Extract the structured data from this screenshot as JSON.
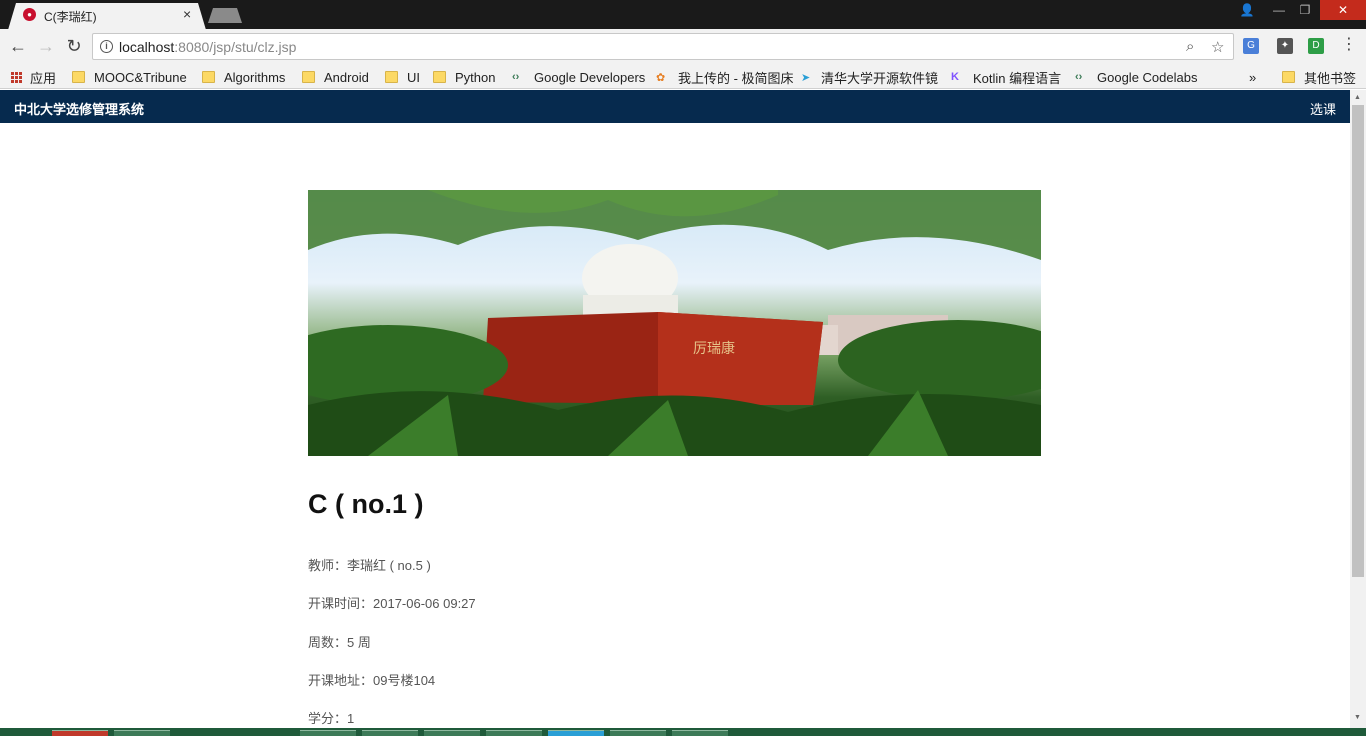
{
  "browser": {
    "tab_title": "C(李瑞红)",
    "tab_close": "×",
    "url_host": "localhost",
    "url_rest": ":8080/jsp/stu/clz.jsp",
    "profile_icon": "person-icon",
    "bookmarks": [
      {
        "label": "应用",
        "icon": "apps-icon"
      },
      {
        "label": "MOOC&Tribune",
        "icon": "folder-icon"
      },
      {
        "label": "Algorithms",
        "icon": "folder-icon"
      },
      {
        "label": "Android",
        "icon": "folder-icon"
      },
      {
        "label": "UI",
        "icon": "folder-icon"
      },
      {
        "label": "Python",
        "icon": "folder-icon"
      },
      {
        "label": "Google Developers",
        "icon": "google-dev-icon"
      },
      {
        "label": "我上传的 - 极简图床",
        "icon": "pinwheel-icon"
      },
      {
        "label": "清华大学开源软件镜",
        "icon": "tuna-icon"
      },
      {
        "label": "Kotlin 编程语言",
        "icon": "kotlin-icon"
      },
      {
        "label": "Google Codelabs",
        "icon": "google-dev-icon"
      }
    ],
    "bookmarks_overflow": "»",
    "other_bookmarks": "其他书签"
  },
  "navbar": {
    "brand": "中北大学选修管理系统",
    "link": "选课"
  },
  "course": {
    "title": "C ( no.1 )",
    "teacher": "教师：李瑞红 ( no.5 )",
    "start_time": "开课时间：2017-06-06 09:27",
    "weeks": "周数：5 周",
    "location": "开课地址：09号楼104",
    "credits": "学分：1"
  },
  "hero_image": {
    "description_icon": "campus-statue-photo",
    "plinth_text": "厉瑞康"
  }
}
